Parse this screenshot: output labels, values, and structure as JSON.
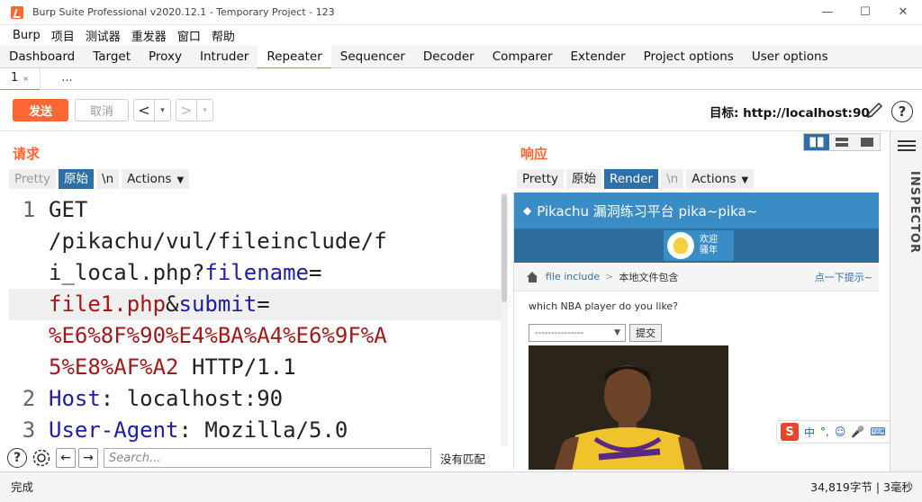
{
  "window": {
    "title": "Burp Suite Professional v2020.12.1 - Temporary Project - 123",
    "minimize": "—",
    "maximize": "☐",
    "close": "✕"
  },
  "menubar": [
    "Burp",
    "项目",
    "测试器",
    "重发器",
    "窗口",
    "帮助"
  ],
  "tabs": [
    "Dashboard",
    "Target",
    "Proxy",
    "Intruder",
    "Repeater",
    "Sequencer",
    "Decoder",
    "Comparer",
    "Extender",
    "Project options",
    "User options"
  ],
  "active_tab": "Repeater",
  "subtabs": {
    "first": "1",
    "close": "×",
    "add": "..."
  },
  "toolbar": {
    "send": "发送",
    "cancel": "取消",
    "back": "<",
    "forward": ">",
    "dropdown": "▾",
    "target": "目标: http://localhost:90",
    "help": "?"
  },
  "request": {
    "title": "请求",
    "tabs": {
      "pretty": "Pretty",
      "raw": "原始",
      "newline": "\\n",
      "actions": "Actions"
    },
    "lines": [
      {
        "ln": "1",
        "text": "GET"
      },
      {
        "ln": "",
        "text": "/pikachu/vul/fileinclude/f"
      },
      {
        "ln": "",
        "text": "i_local.php?",
        "key": "filename",
        "op": "="
      },
      {
        "ln": "",
        "value": "file1.php",
        "amp": "&",
        "key": "submit",
        "op": "="
      },
      {
        "ln": "",
        "value": "%E6%8F%90%E4%BA%A4%E6%9F%A"
      },
      {
        "ln": "",
        "value": "5%E8%AF%A2",
        "text": " HTTP/1.1"
      },
      {
        "ln": "2",
        "key": "Host",
        "text": ": localhost:90"
      },
      {
        "ln": "3",
        "key": "User-Agent",
        "text": ": Mozilla/5.0"
      }
    ],
    "search_placeholder": "Search...",
    "no_match": "没有匹配"
  },
  "response": {
    "title": "响应",
    "tabs": {
      "pretty": "Pretty",
      "raw": "原始",
      "render": "Render",
      "newline": "\\n",
      "actions": "Actions"
    },
    "render": {
      "site_title": "Pikachu 漏洞练习平台 pika~pika~",
      "welcome": [
        "欢迎",
        "骚年"
      ],
      "breadcrumb_link": "file include",
      "breadcrumb_sep": ">",
      "breadcrumb_current": "本地文件包含",
      "tip": "点一下提示~",
      "question": "which NBA player do you like?",
      "select_value": "---------------",
      "submit": "提交"
    }
  },
  "ime": {
    "logo": "S",
    "items": [
      "中",
      "°,",
      "☺",
      "🎤",
      "⌨",
      "👕",
      "▦"
    ]
  },
  "inspector": {
    "label": "INSPECTOR"
  },
  "status": {
    "left": "完成",
    "right": "34,819字节 | 3毫秒"
  },
  "colors": {
    "accent": "#ff6633",
    "selected_tab": "#2e6fa7",
    "key": "#1d1da8",
    "value": "#a31818",
    "pikachu_blue": "#3a8cc4"
  }
}
